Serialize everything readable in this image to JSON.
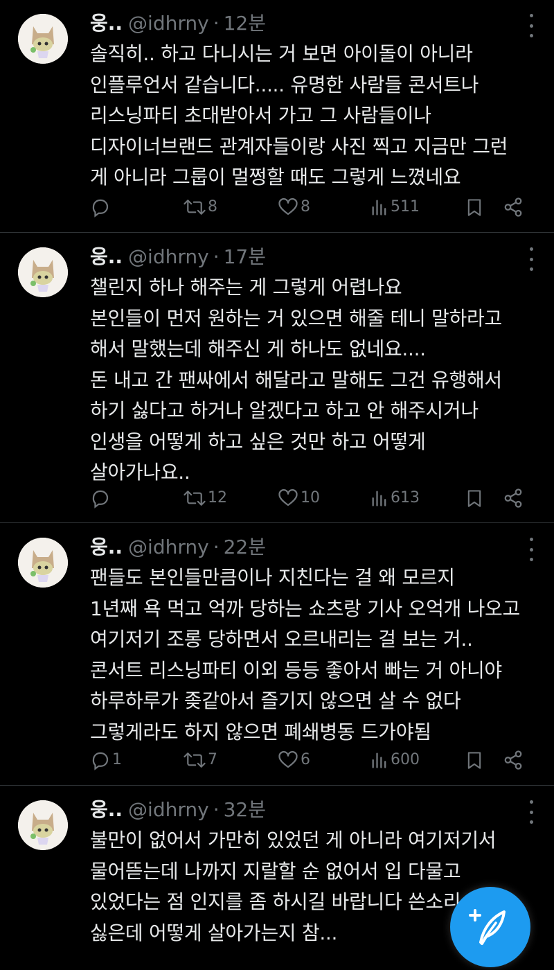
{
  "tweets": [
    {
      "name": "웅..",
      "handle": "@idhrny",
      "time": "12분",
      "text": "솔직히.. 하고 다니시는 거 보면 아이돌이 아니라\n인플루언서 같습니다..... 유명한 사람들 콘서트나\n리스닝파티 초대받아서 가고 그 사람들이나\n디자이너브랜드 관계자들이랑 사진 찍고 지금만 그런\n게 아니라 그룹이 멀쩡할 때도 그렇게 느꼈네요",
      "replies": "",
      "retweets": "8",
      "likes": "8",
      "views": "511"
    },
    {
      "name": "웅..",
      "handle": "@idhrny",
      "time": "17분",
      "text": "챌린지 하나 해주는 게 그렇게 어렵나요\n본인들이 먼저 원하는 거 있으면 해줄 테니 말하라고\n해서 말했는데 해주신 게 하나도 없네요....\n돈 내고 간 팬싸에서 해달라고 말해도 그건 유행해서\n하기 싫다고 하거나 알겠다고 하고 안 해주시거나\n인생을 어떻게 하고 싶은 것만 하고 어떻게\n살아가나요..",
      "replies": "",
      "retweets": "12",
      "likes": "10",
      "views": "613"
    },
    {
      "name": "웅..",
      "handle": "@idhrny",
      "time": "22분",
      "text": "팬들도 본인들만큼이나 지친다는 걸 왜 모르지\n1년째 욕 먹고 억까 당하는 쇼츠랑 기사 오억개 나오고\n여기저기 조롱 당하면서 오르내리는 걸 보는 거..\n콘서트 리스닝파티 이외 등등 좋아서 빠는 거 아니야\n하루하루가 좆같아서 즐기지 않으면 살 수 없다\n그렇게라도 하지 않으면 폐쇄병동 드가야됨",
      "replies": "1",
      "retweets": "7",
      "likes": "6",
      "views": "600"
    },
    {
      "name": "웅..",
      "handle": "@idhrny",
      "time": "32분",
      "text": "불만이 없어서 가만히 있었던 게 아니라 여기저기서\n물어뜯는데 나까지 지랄할 순 없어서 입 다물고\n있었다는 점 인지를 좀 하시길 바랍니다 쓴소리 듣기\n싫은데 어떻게 살아가는지 참...",
      "replies": "",
      "retweets": "",
      "likes": "",
      "views": ""
    }
  ],
  "fab": {
    "icon": "compose-icon"
  },
  "colors": {
    "background": "#000000",
    "text": "#e7e9ea",
    "secondary": "#71767b",
    "divider": "#2f3336",
    "accent": "#1d9bf0"
  }
}
